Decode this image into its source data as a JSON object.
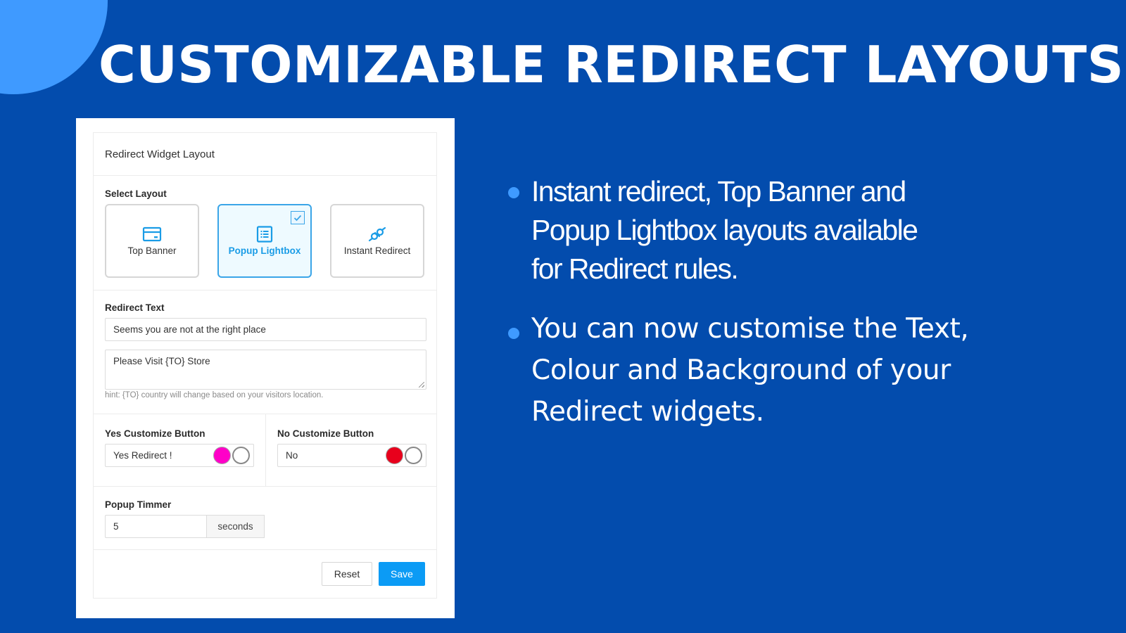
{
  "colors": {
    "background": "#034cad",
    "accent_circle": "#3f9aff",
    "bullet_dot": "#3f9aff",
    "selected_border": "#3aa5e8",
    "save_button": "#0b9bf5",
    "yes_button_color": "#ff00c8",
    "no_button_color": "#e8001c"
  },
  "headline": "CUSTOMIZABLE REDIRECT LAYOUTS",
  "panel": {
    "title": "Redirect Widget Layout",
    "select_layout": {
      "label": "Select Layout",
      "options": [
        {
          "label": "Top Banner",
          "icon": "banner-icon",
          "selected": false
        },
        {
          "label": "Popup Lightbox",
          "icon": "list-icon",
          "selected": true
        },
        {
          "label": "Instant Redirect",
          "icon": "plug-icon",
          "selected": false
        }
      ]
    },
    "redirect_text": {
      "label": "Redirect Text",
      "line1_value": "Seems you are not at the right place",
      "line2_value": "Please Visit {TO} Store",
      "hint": "hint: {TO} country will change based on your visitors location."
    },
    "yes_button": {
      "label": "Yes Customize Button",
      "value": "Yes Redirect !"
    },
    "no_button": {
      "label": "No Customize Button",
      "value": "No"
    },
    "popup_timer": {
      "label": "Popup Timmer",
      "value": "5",
      "unit": "seconds"
    },
    "footer": {
      "reset_label": "Reset",
      "save_label": "Save"
    }
  },
  "bullets": [
    "Instant redirect, Top Banner and Popup Lightbox layouts available for Redirect rules.",
    "You can now customise the Text, Colour and Background of your Redirect widgets."
  ]
}
